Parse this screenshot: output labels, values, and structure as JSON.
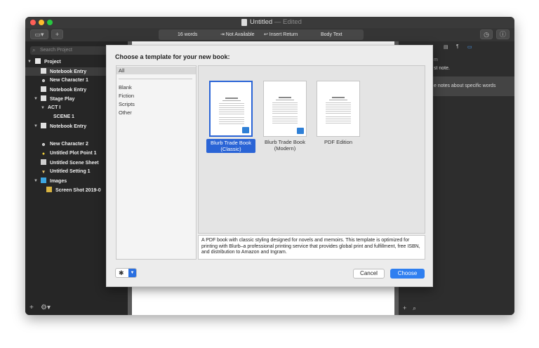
{
  "window": {
    "title": "Untitled",
    "title_suffix": "— Edited"
  },
  "toolbar": {
    "word_count": "16 words",
    "not_available": "⇥ Not Available",
    "insert_return": "↩ Insert Return",
    "body_text": "Body Text"
  },
  "binder": {
    "search_placeholder": "Search Project",
    "items": [
      {
        "label": "Project"
      },
      {
        "label": "Notebook Entry"
      },
      {
        "label": "New Character 1"
      },
      {
        "label": "Notebook Entry"
      },
      {
        "label": "Stage Play"
      },
      {
        "label": "ACT I"
      },
      {
        "label": "SCENE 1"
      },
      {
        "label": "Notebook Entry"
      },
      {
        "label": "New Character 2"
      },
      {
        "label": "Untitled Plot Point 1"
      },
      {
        "label": "Untitled Scene Sheet"
      },
      {
        "label": "Untitled Setting 1"
      },
      {
        "label": "Images"
      },
      {
        "label": "Screen Shot 2019-0"
      }
    ]
  },
  "inspector": {
    "line1": "m",
    "line2": "st note.",
    "line3": "e notes about specific words"
  },
  "sheet": {
    "title": "Choose a template for your new book:",
    "categories": [
      "All",
      "Blank",
      "Fiction",
      "Scripts",
      "Other"
    ],
    "templates": [
      {
        "name": "Blurb Trade Book (Classic)",
        "selected": true
      },
      {
        "name": "Blurb Trade Book (Modern)",
        "selected": false
      },
      {
        "name": "PDF Edition",
        "selected": false
      }
    ],
    "description": "A PDF book with classic styling designed for novels and memoirs. This template is optimized for printing with Blurb–a professional printing service that provides global print and fulfillment, free ISBN, and distribution to Amazon and Ingram.",
    "cancel_label": "Cancel",
    "choose_label": "Choose"
  },
  "colors": {
    "accent": "#2f7ff0",
    "selection": "#2a64d6",
    "sidebar_bg": "#262626"
  }
}
